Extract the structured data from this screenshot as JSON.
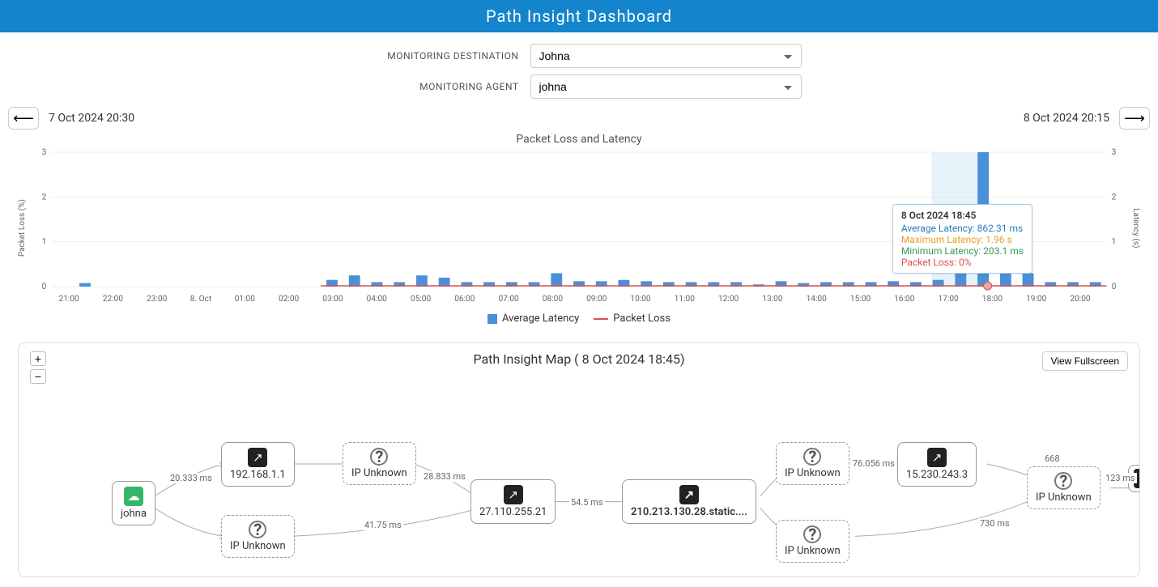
{
  "header": {
    "title": "Path Insight Dashboard"
  },
  "filters": {
    "destination_label": "MONITORING DESTINATION",
    "destination_value": "Johna",
    "agent_label": "MONITORING AGENT",
    "agent_value": "johna"
  },
  "timerange": {
    "start": "7 Oct 2024 20:30",
    "end": "8 Oct 2024 20:15"
  },
  "chart": {
    "title": "Packet Loss and Latency",
    "ylabel_left": "Packet Loss (%)",
    "ylabel_right": "Latency (s)",
    "legend_avg": "Average Latency",
    "legend_loss": "Packet Loss",
    "tooltip": {
      "time": "8 Oct 2024 18:45",
      "avg": "Average Latency: 862.31 ms",
      "max": "Maximum Latency: 1.96 s",
      "min": "Minimum Latency: 203.1 ms",
      "loss": "Packet Loss: 0%"
    }
  },
  "chart_data": {
    "type": "bar",
    "title": "Packet Loss and Latency",
    "xlabel": "",
    "ylabel_left": "Packet Loss (%)",
    "ylabel_right": "Latency (s)",
    "ylim_left": [
      0,
      3
    ],
    "ylim_right": [
      0,
      3
    ],
    "x_ticks": [
      "21:00",
      "22:00",
      "23:00",
      "8. Oct",
      "01:00",
      "02:00",
      "03:00",
      "04:00",
      "05:00",
      "06:00",
      "07:00",
      "08:00",
      "09:00",
      "10:00",
      "11:00",
      "12:00",
      "13:00",
      "14:00",
      "15:00",
      "16:00",
      "17:00",
      "18:00",
      "19:00",
      "20:00"
    ],
    "y_ticks": [
      0,
      1,
      2,
      3
    ],
    "series": [
      {
        "name": "Average Latency",
        "unit": "s",
        "color": "#4a90d9",
        "values": [
          0,
          0.08,
          0,
          0,
          0,
          0,
          0,
          0,
          0,
          0,
          0,
          0,
          0.15,
          0.25,
          0.1,
          0.1,
          0.25,
          0.2,
          0.1,
          0.1,
          0.1,
          0.1,
          0.3,
          0.12,
          0.12,
          0.15,
          0.12,
          0.1,
          0.1,
          0.1,
          0.1,
          0.05,
          0.12,
          0.08,
          0.1,
          0.1,
          0.1,
          0.12,
          0.1,
          0.15,
          0.86,
          3.0,
          0.6,
          0.3,
          0.1,
          0.1,
          0.1
        ]
      },
      {
        "name": "Packet Loss",
        "unit": "%",
        "color": "#d9534f",
        "values": [
          0,
          0,
          0,
          0,
          0,
          0,
          0,
          0,
          0,
          0,
          0,
          0,
          0,
          0,
          0,
          0,
          0,
          0,
          0,
          0,
          0,
          0,
          0,
          0,
          0,
          0,
          0,
          0,
          0,
          0,
          0,
          0,
          0,
          0,
          0,
          0,
          0,
          0,
          0,
          0,
          0,
          0,
          0,
          0,
          0,
          0,
          0
        ]
      }
    ],
    "selected_index": 40
  },
  "map": {
    "title_prefix": "Path Insight Map ( ",
    "title_time": "8 Oct 2024 18:45",
    "title_suffix": ")",
    "fullscreen": "View Fullscreen",
    "nodes": {
      "agent": "johna",
      "n1": "192.168.1.1",
      "n2": "IP Unknown",
      "n3": "IP Unknown",
      "n4": "27.110.255.21",
      "n5": "210.213.130.28.static....",
      "n6": "IP Unknown",
      "n7": "IP Unknown",
      "n8": "15.230.243.3",
      "n9": "IP Unknown",
      "n10_ms": "123 ms"
    },
    "edges": {
      "e_agent_n1": "20.333 ms",
      "e_n1_n2": "",
      "e_n2_n4": "28.833 ms",
      "e_n3_n4": "41.75 ms",
      "e_n4_n5": "54.5 ms",
      "e_n6_n8": "76.056 ms",
      "e_n8_n9": "668",
      "e_n7_n9": "730 ms"
    }
  }
}
